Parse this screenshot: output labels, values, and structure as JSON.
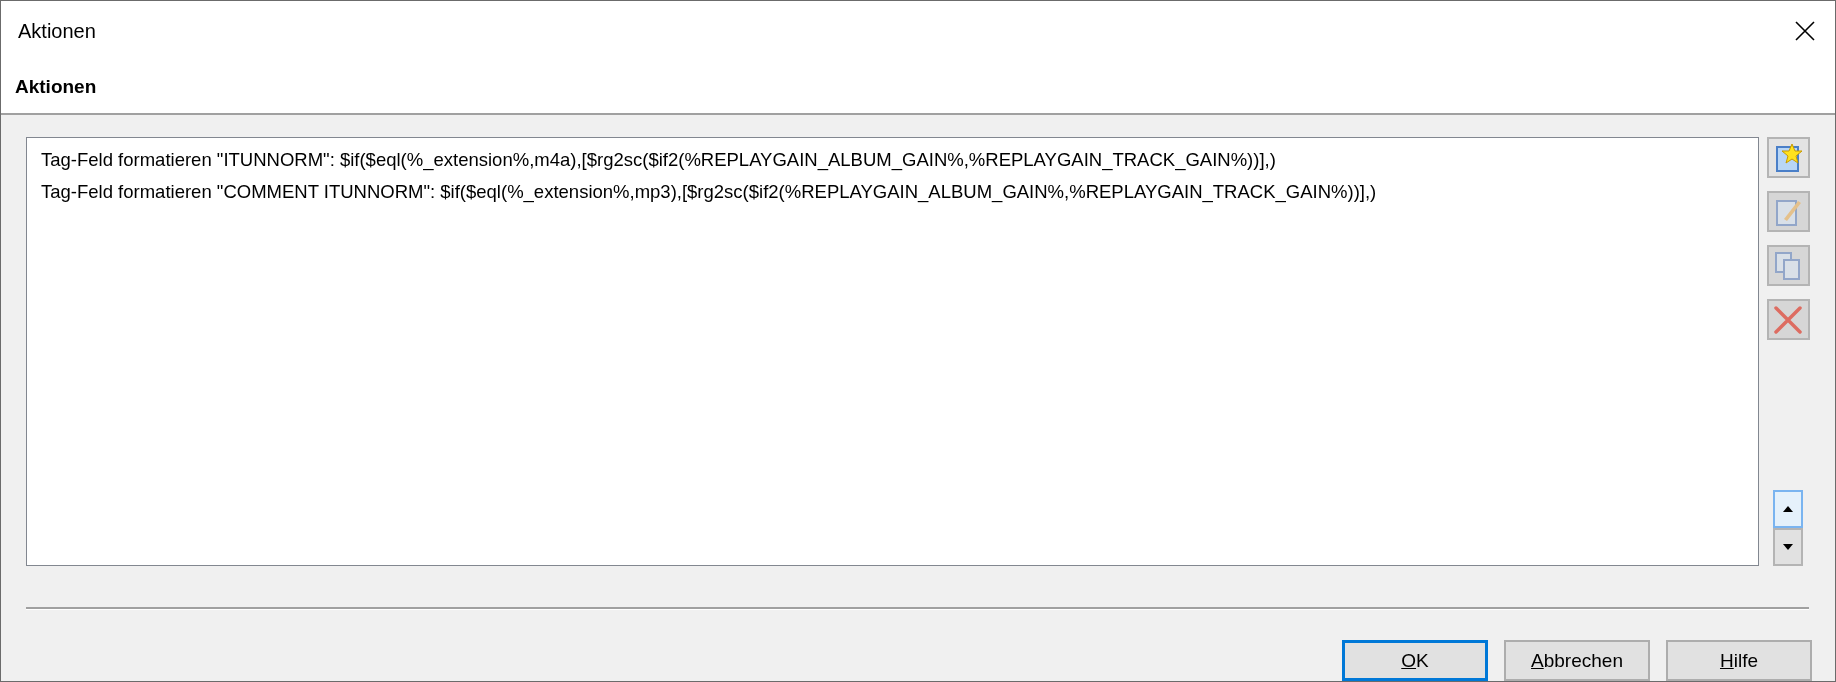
{
  "window": {
    "title": "Aktionen"
  },
  "header": "Aktionen",
  "actions": [
    {
      "text": "Tag-Feld formatieren \"ITUNNORM\": $if($eql(%_extension%,m4a),[$rg2sc($if2(%REPLAYGAIN_ALBUM_GAIN%,%REPLAYGAIN_TRACK_GAIN%))],)",
      "selected": false
    },
    {
      "text": "Tag-Feld formatieren \"COMMENT ITUNNORM\": $if($eql(%_extension%,mp3),[$rg2sc($if2(%REPLAYGAIN_ALBUM_GAIN%,%REPLAYGAIN_TRACK_GAIN%))],)",
      "selected": false
    }
  ],
  "side_tools": [
    {
      "kind": "new",
      "disabled": false
    },
    {
      "kind": "edit",
      "disabled": true
    },
    {
      "kind": "copy",
      "disabled": true
    },
    {
      "kind": "delete",
      "disabled": true
    }
  ],
  "move_buttons": [
    {
      "kind": "up",
      "focused": true
    },
    {
      "kind": "down",
      "focused": false
    }
  ],
  "buttons": [
    {
      "label": "OK",
      "default": true
    },
    {
      "label": "Abbrechen",
      "default": false
    },
    {
      "label": "Hilfe",
      "default": false
    }
  ]
}
